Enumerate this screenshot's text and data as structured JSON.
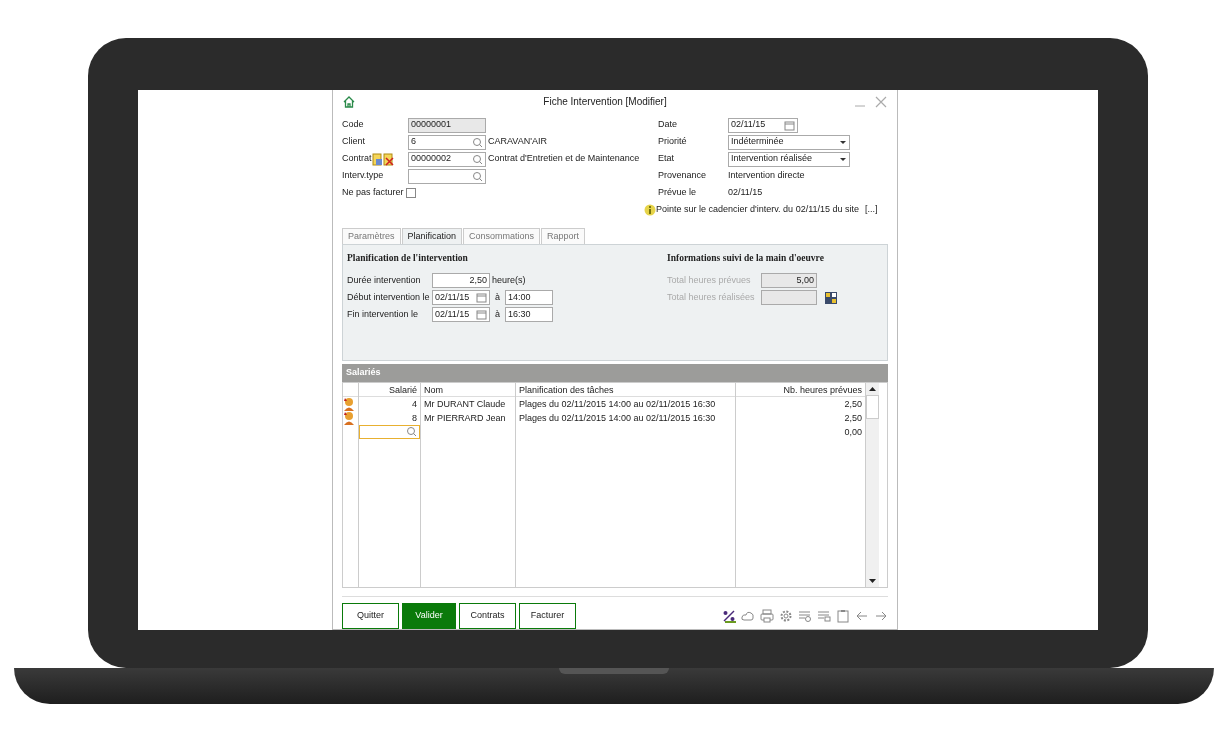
{
  "window": {
    "title": "Fiche Intervention [Modifier]"
  },
  "form_left": [
    {
      "label": "Code",
      "kind": "readonly",
      "value": "00000001"
    },
    {
      "label": "Client",
      "kind": "lookup",
      "value": "6",
      "text": "CARAVAN'AIR"
    },
    {
      "label": "Contrat",
      "kind": "lookup",
      "value": "00000002",
      "text": "Contrat d'Entretien et de Maintenance",
      "contract_icons": true
    },
    {
      "label": "Interv.type",
      "kind": "lookup"
    },
    {
      "label": "Ne pas facturer",
      "kind": "checkbox",
      "checked": false
    }
  ],
  "form_right": [
    {
      "label": "Date",
      "kind": "date",
      "value": "02/11/15"
    },
    {
      "label": "Priorité",
      "kind": "select",
      "value": "Indéterminée"
    },
    {
      "label": "Etat",
      "kind": "select",
      "value": "Intervention réalisée"
    },
    {
      "label": "Provenance",
      "kind": "text",
      "value": "Intervention directe"
    },
    {
      "label": "Prévue le",
      "kind": "text",
      "value": "02/11/15"
    }
  ],
  "notice": {
    "text": "Pointe sur le cadencier d'interv. du 02/11/15 du site",
    "link": "[...]"
  },
  "tabs": [
    {
      "label": "Paramètres",
      "selected": false
    },
    {
      "label": "Planification",
      "selected": true
    },
    {
      "label": "Consommations",
      "selected": false
    },
    {
      "label": "Rapport",
      "selected": false
    }
  ],
  "planning": {
    "title": "Planification de l'intervention",
    "duration": {
      "label": "Durée intervention",
      "value": "2,50",
      "unit": "heure(s)"
    },
    "periods": [
      {
        "label": "Début intervention le",
        "date": "02/11/15",
        "sep": "à",
        "time": "14:00"
      },
      {
        "label": "Fin intervention le",
        "date": "02/11/15",
        "sep": "à",
        "time": "16:30"
      }
    ]
  },
  "labour": {
    "title": "Informations suivi de la main d'oeuvre",
    "rows": [
      {
        "label": "Total heures prévues",
        "value": "5,00",
        "disabled": true,
        "button": false
      },
      {
        "label": "Total heures réalisées",
        "disabled": true,
        "button": true
      }
    ]
  },
  "salaries": {
    "title": "Salariés",
    "columns": [
      "Salarié",
      "Nom",
      "Planification des tâches",
      "Nb. heures prévues"
    ],
    "rows": [
      {
        "salarie": "4",
        "nom": "Mr DURANT Claude",
        "planification": "Plages du 02/11/2015 14:00 au 02/11/2015 16:30",
        "heures": "2,50"
      },
      {
        "salarie": "8",
        "nom": "Mr PIERRARD Jean",
        "planification": "Plages du 02/11/2015 14:00 au 02/11/2015 16:30",
        "heures": "2,50"
      }
    ],
    "new_row": {
      "heures": "0,00"
    }
  },
  "buttons": [
    {
      "label": "Quitter",
      "primary": false
    },
    {
      "label": "Valider",
      "primary": true
    },
    {
      "label": "Contrats",
      "primary": false
    },
    {
      "label": "Facturer",
      "primary": false
    }
  ]
}
